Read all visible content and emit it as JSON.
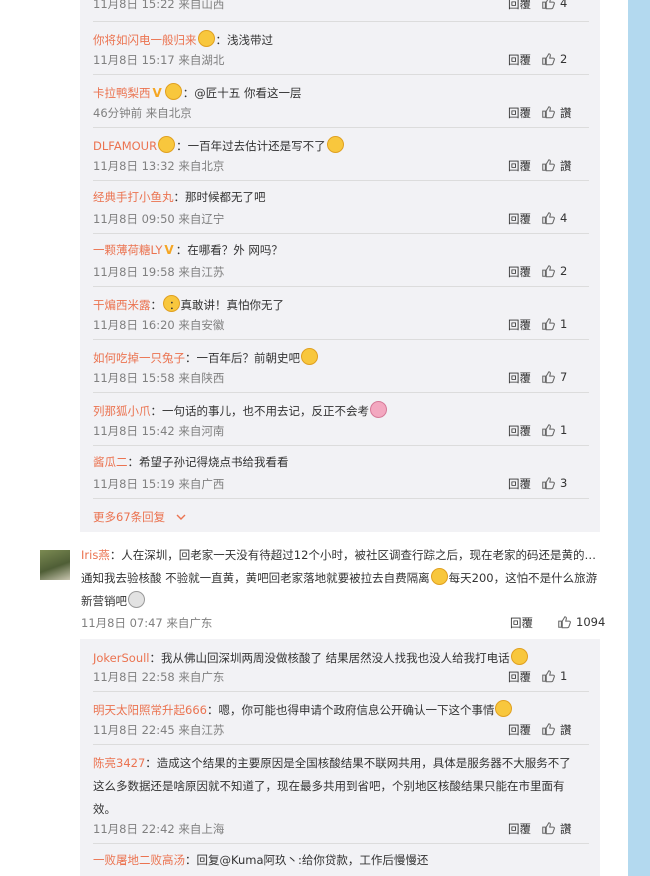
{
  "top_partial": {
    "time": "11月8日 15:22 来自山西",
    "reply": "回覆",
    "likes": "4"
  },
  "subcomments": [
    {
      "user": "你将如闪电一般归来",
      "emoji": "yellow",
      "text": "：浅浅带过",
      "time": "11月8日 15:17 来自湖北",
      "reply": "回覆",
      "likes": "2"
    },
    {
      "user": "卡拉鸭梨西",
      "badge": "V",
      "emoji": "yellow",
      "text": "：@匠十五 你看这一层",
      "time": "46分钟前 来自北京",
      "reply": "回覆",
      "likes": "讚"
    },
    {
      "user": "DLFAMOUR",
      "emoji": "yellow",
      "text": "：一百年过去估计还是写不了",
      "emoji2": "yellow",
      "time": "11月8日 13:32 来自北京",
      "reply": "回覆",
      "likes": "讚"
    },
    {
      "user": "经典手打小鱼丸",
      "text": "：那时候都无了吧",
      "time": "11月8日 09:50 来自辽宁",
      "reply": "回覆",
      "likes": "4"
    },
    {
      "user": "一颗薄荷糖LY",
      "badge": "V",
      "text": "：在哪看？外 网吗？",
      "time": "11月8日 19:58 来自江苏",
      "reply": "回覆",
      "likes": "2"
    },
    {
      "user": "干煸西米露",
      "pre_emoji": "yellow",
      "text": "：真敢讲！真怕你无了",
      "time": "11月8日 16:20 来自安徽",
      "reply": "回覆",
      "likes": "1"
    },
    {
      "user": "如何吃掉一只兔子",
      "text": "：一百年后？前朝史吧",
      "emoji2": "yellow",
      "time": "11月8日 15:58 来自陕西",
      "reply": "回覆",
      "likes": "7"
    },
    {
      "user": "列那狐小爪",
      "text": "：一句话的事儿，也不用去记，反正不会考",
      "emoji2": "pink",
      "time": "11月8日 15:42 来自河南",
      "reply": "回覆",
      "likes": "1"
    },
    {
      "user": "酱瓜二",
      "text": "：希望子孙记得烧点书给我看看",
      "time": "11月8日 15:19 来自广西",
      "reply": "回覆",
      "likes": "3"
    }
  ],
  "more_replies": "更多67条回复",
  "main_comment": {
    "user": "Iris燕",
    "text": "：人在深圳，回老家一天没有待超过12个小时，被社区调查行踪之后，现在老家的码还是黄的…通知我去验核酸 不验就一直黄，黄吧回老家落地就要被拉去自费隔离",
    "text_after": "每天200，这怕不是什么旅游新营销吧",
    "time": "11月8日 07:47 来自广东",
    "reply": "回覆",
    "likes": "1094"
  },
  "replies2": [
    {
      "user": "JokerSoull",
      "text": "：我从佛山回深圳两周没做核酸了 结果居然没人找我也没人给我打电话",
      "emoji2": "yellow",
      "time": "11月8日 22:58 来自广东",
      "reply": "回覆",
      "likes": "1"
    },
    {
      "user": "明天太阳照常升起666",
      "text": "：嗯，你可能也得申请个政府信息公开确认一下这个事情",
      "emoji2": "yellow",
      "time": "11月8日 22:45 来自江苏",
      "reply": "回覆",
      "likes": "讚"
    },
    {
      "user": "陈亮3427",
      "text_lines": [
        "：造成这个结果的主要原因是全国核酸结果不联网共用，具体是服务器不大服务不了",
        "这么多数据还是啥原因就不知道了，现在最多共用到省吧，个别地区核酸结果只能在市里面有",
        "效。"
      ],
      "time": "11月8日 22:42 来自上海",
      "reply": "回覆",
      "likes": "讚"
    },
    {
      "user": "一败屠地二败高汤",
      "text": "：回复@Kuma阿玖丶:给你贷款，工作后慢慢还"
    }
  ]
}
